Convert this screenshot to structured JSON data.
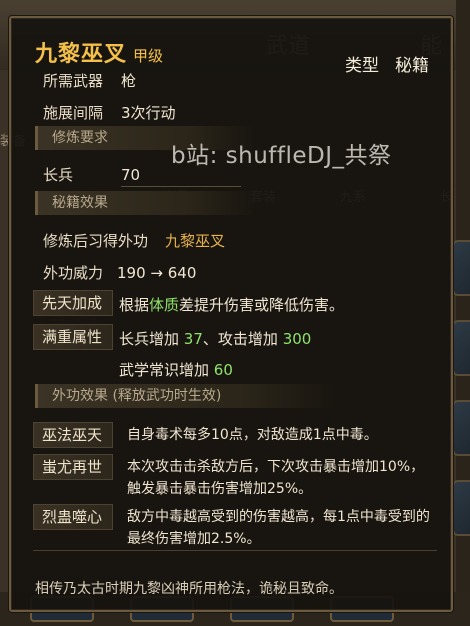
{
  "background": {
    "tabs": [
      "武道",
      "能"
    ],
    "chips": [
      "装备",
      "普通",
      "套装",
      "九系",
      "长"
    ]
  },
  "skill": {
    "name": "九黎巫叉",
    "grade": "甲级",
    "type_label": "类型",
    "book_label": "秘籍",
    "required_weapon_label": "所需武器",
    "required_weapon": "枪",
    "cast_interval_label": "施展间隔",
    "cast_interval": "3次行动"
  },
  "watermark": "b站: shuffleDJ_共祭",
  "requirement": {
    "header": "修炼要求",
    "stat_label": "长兵",
    "stat_value": "70"
  },
  "effects": {
    "header": "秘籍效果",
    "learn_label": "修炼后习得外功",
    "learn_value": "九黎巫叉",
    "power_label": "外功威力",
    "power_value": "190 → 640",
    "innate_label": "先天加成",
    "innate_prefix": "根据",
    "innate_highlight": "体质",
    "innate_suffix": "差提升伤害或降低伤害。",
    "full_label": "满重属性",
    "full_line1_a": "长兵增加",
    "full_line1_a_val": "37",
    "full_line1_b": "、攻击增加",
    "full_line1_b_val": "300",
    "full_line2_a": "武学常识增加",
    "full_line2_a_val": "60"
  },
  "external": {
    "header": "外功效果 (释放武功时生效)",
    "items": [
      {
        "label": "巫法巫天",
        "text": "自身毒术每多10点，对敌造成1点中毒。"
      },
      {
        "label": "蚩尤再世",
        "text": "本次攻击击杀敌方后，下次攻击暴击增加10%，触发暴击暴击伤害增加25%。"
      },
      {
        "label": "烈蛊噬心",
        "text": "敌方中毒越高受到的伤害越高，每1点中毒受到的最终伤害增加2.5%。"
      }
    ]
  },
  "footer": "相传乃太古时期九黎凶神所用枪法，诡秘且致命。",
  "colors": {
    "gold": "#e8b24a",
    "green": "#8fe36a",
    "title": "#f4c04a"
  }
}
